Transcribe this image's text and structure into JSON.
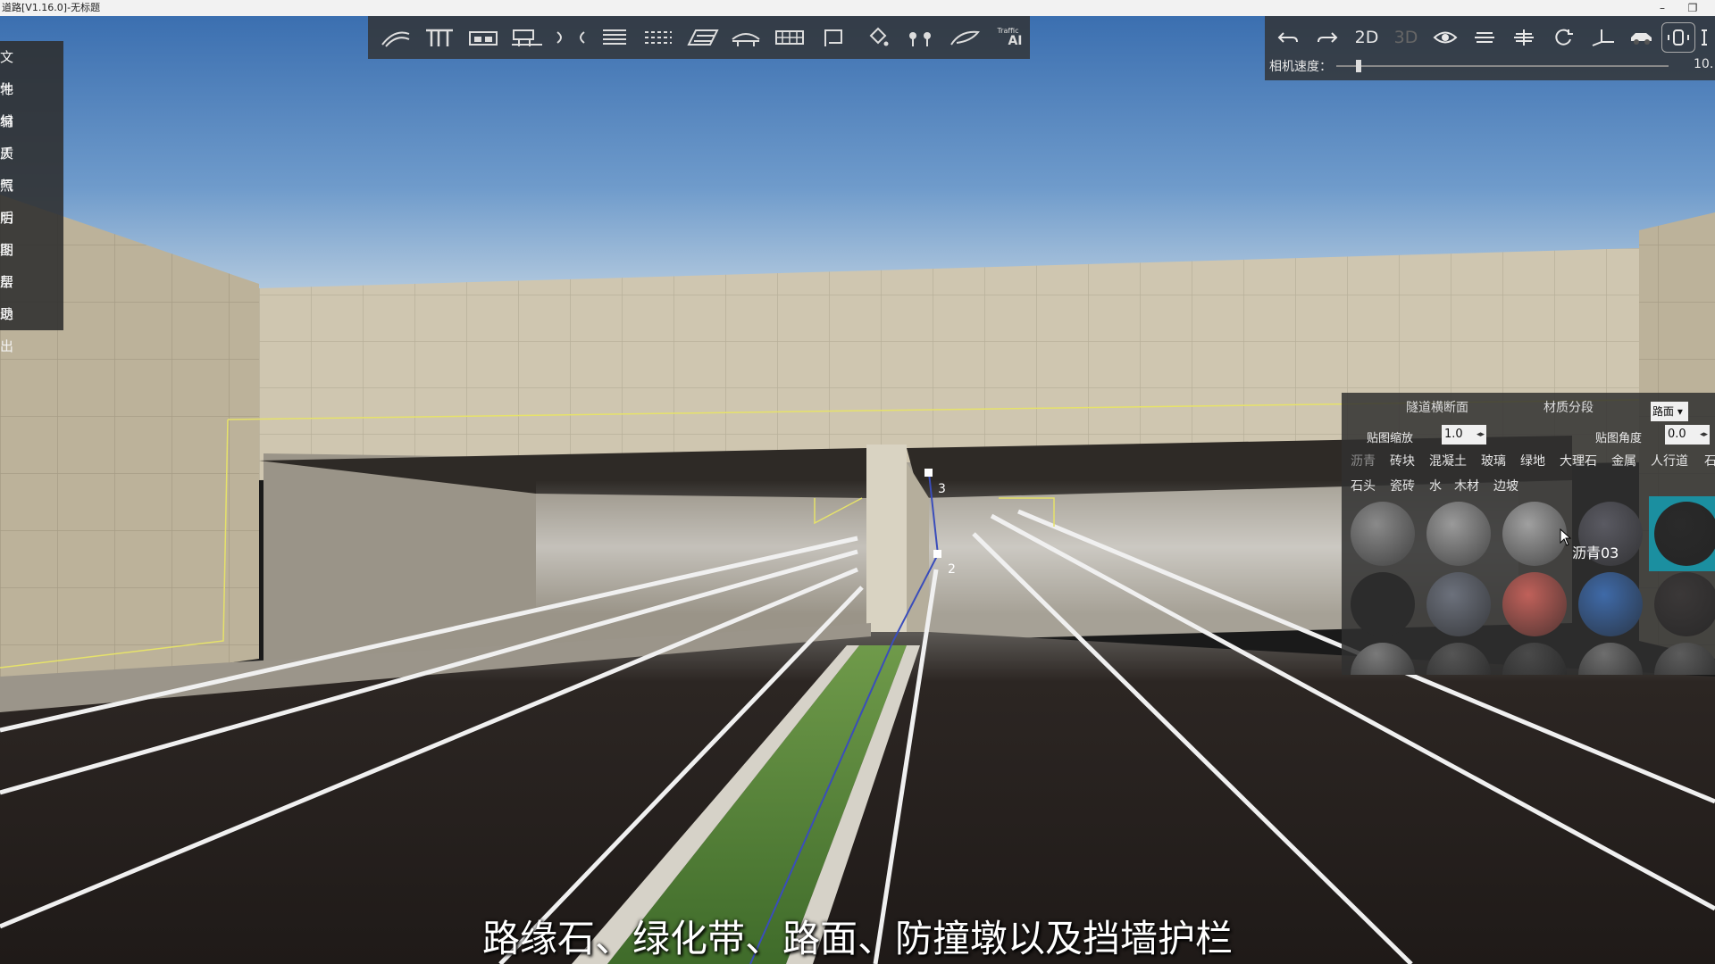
{
  "window": {
    "title": "道路[V1.16.0]-无标题",
    "minimize": "–",
    "restore": "❐"
  },
  "left_menu": [
    "文件",
    "地编",
    "材质",
    "天气",
    "照明",
    "后期",
    "图层",
    "帮助",
    "退出"
  ],
  "top_tools": [
    "curve-road-icon",
    "t-road-icon",
    "cross-section-icon",
    "bridge-icon",
    "tunnel-icon",
    "lane-lines-icon",
    "dashed-lines-icon",
    "crosswalk-icon",
    "overpass-icon",
    "barrier-icon",
    "sign-icon",
    "paint-bucket-icon",
    "trees-icon",
    "vegetation-icon",
    "traffic-ai-icon"
  ],
  "traffic_ai_label": {
    "top": "Traffic",
    "bottom": "AI"
  },
  "view_controls": {
    "undo": "undo-icon",
    "redo": "redo-icon",
    "mode_2d": "2D",
    "mode_3d": "3D",
    "camera_speed_label": "相机速度：",
    "camera_speed_value": "10.",
    "camera_speed_fraction": 0.06
  },
  "material_panel": {
    "tab_cross_section": "隧道横断面",
    "tab_material_segment": "材质分段",
    "dropdown_value": "路面",
    "scale_label": "贴图缩放",
    "scale_value": "1.0",
    "angle_label": "贴图角度",
    "angle_value": "0.0",
    "categories_row1": [
      "沥青",
      "砖块",
      "混凝土",
      "玻璃",
      "绿地",
      "大理石",
      "金属",
      "人行道",
      "石"
    ],
    "categories_row2": [
      "石头",
      "瓷砖",
      "水",
      "木材",
      "边坡"
    ],
    "selected_category": "沥青",
    "tooltip": "沥青03",
    "swatch_colors": [
      "#8a8a8a",
      "#9a9a9a",
      "#a0a0a0",
      "#5a5a62",
      "#2a2a2a",
      "#3a3a3a",
      "#6c717c",
      "#c0615a",
      "#3f6aa8",
      "#3b3838",
      "#7a7a7a",
      "#555555",
      "#4a4a4a",
      "#6e6e6e",
      "#5c5c5c"
    ]
  },
  "viewport_markers": {
    "point_a": "3",
    "point_b": "2"
  },
  "subtitle": "路缘石、绿化带、路面、防撞墩以及挡墙护栏"
}
